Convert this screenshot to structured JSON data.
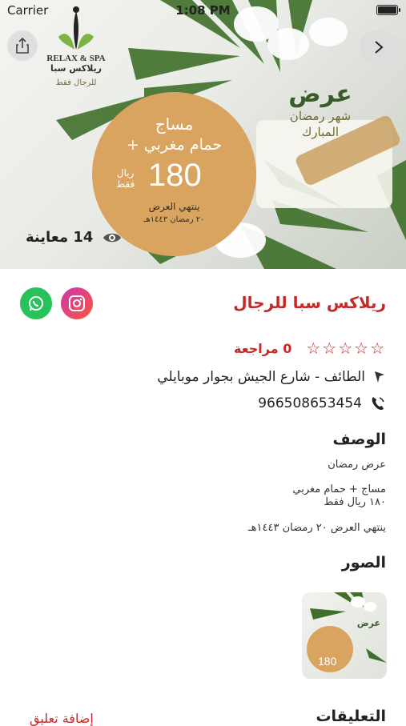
{
  "status": {
    "carrier": "Carrier",
    "time": "1:08 PM"
  },
  "hero": {
    "logo_en": "RELAX & SPA",
    "logo_ar": "ريلاكس سبا",
    "logo_sub": "للرجال فقط",
    "line1": "مساج",
    "line2": "+ حمام مغربي",
    "price": "180",
    "currency_line1": "ريال",
    "currency_line2": "فقط",
    "ends": "ينتهي العرض",
    "ends_date": "٢٠ رمضان ١٤٤٣هـ",
    "offer_title": "عرض",
    "offer_sub1": "شهر رمضان",
    "offer_sub2": "المبارك",
    "views": "14 معاينة"
  },
  "details": {
    "name": "ريلاكس سبا للرجال",
    "reviews": "0 مراجعة",
    "stars": "☆☆☆☆☆",
    "address": "الطائف - شارع الجيش بجوار موبايلي",
    "phone": "966508653454"
  },
  "description": {
    "heading": "الوصف",
    "line1": "عرض رمضان",
    "line2": "مساج + حمام مغربي",
    "line3": "١٨٠ ريال فقط",
    "line4": "ينتهي العرض ٢٠ رمضان ١٤٤٣هـ"
  },
  "photos": {
    "heading": "الصور",
    "thumb_title": "عرض",
    "thumb_price": "180"
  },
  "comments": {
    "heading": "التعليقات",
    "add_label": "إضافة تعليق"
  },
  "colors": {
    "accent": "#c62828",
    "gold": "#d9a45f",
    "whatsapp": "#28c15b"
  }
}
